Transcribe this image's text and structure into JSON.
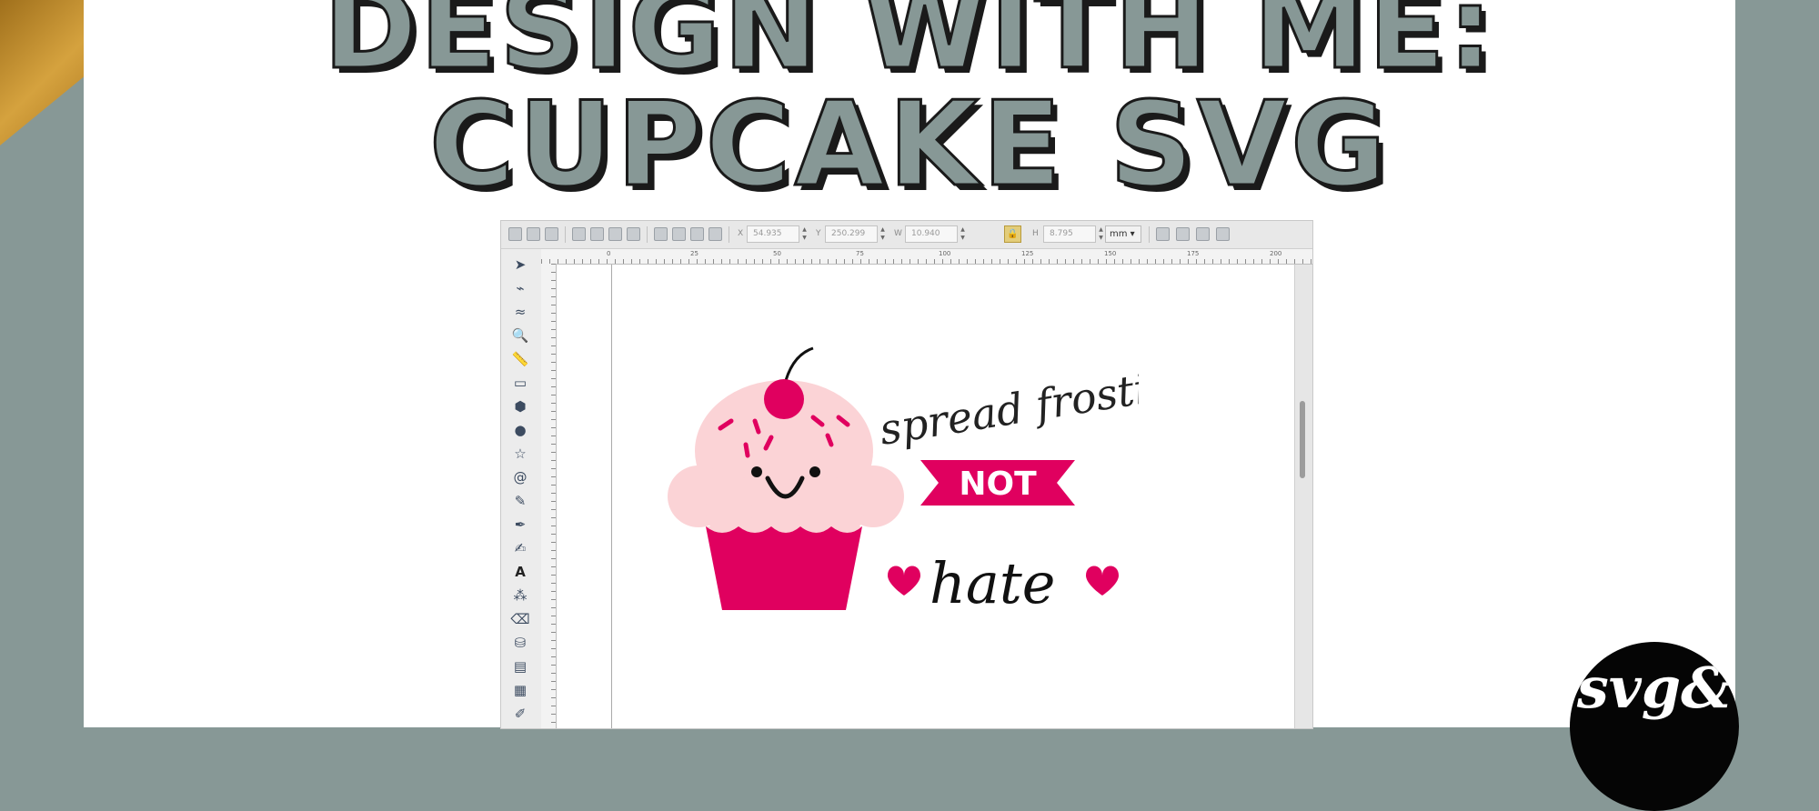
{
  "title": {
    "line1": "Design with me:",
    "line2": "Cupcake SVG"
  },
  "colors": {
    "background": "#879896",
    "title_fill": "#879896",
    "title_outline": "#1a1a1a",
    "gold_accent": "#c99a3a",
    "pink": "#e0005f",
    "light_pink": "#fbd3d6"
  },
  "inkscape": {
    "fields": {
      "x_label": "X",
      "x_value": "54.935",
      "y_label": "Y",
      "y_value": "250.299",
      "w_label": "W",
      "w_value": "10.940",
      "h_label": "H",
      "h_value": "8.795",
      "unit": "mm"
    },
    "ruler_labels": [
      "0",
      "25",
      "50",
      "75",
      "100",
      "125",
      "150",
      "175",
      "200"
    ],
    "tools": [
      "selector-tool-icon",
      "node-tool-icon",
      "tweak-tool-icon",
      "zoom-tool-icon",
      "measure-tool-icon",
      "rectangle-tool-icon",
      "box3d-tool-icon",
      "ellipse-tool-icon",
      "star-tool-icon",
      "spiral-tool-icon",
      "pencil-tool-icon",
      "pen-tool-icon",
      "calligraphy-tool-icon",
      "text-tool-icon",
      "spray-tool-icon",
      "eraser-tool-icon",
      "paint-bucket-tool-icon",
      "gradient-tool-icon",
      "mesh-tool-icon",
      "dropper-tool-icon"
    ]
  },
  "artwork": {
    "script_top": "spread frosting",
    "banner": "NOT",
    "script_bottom": "hate"
  },
  "logo_text": "svg&"
}
